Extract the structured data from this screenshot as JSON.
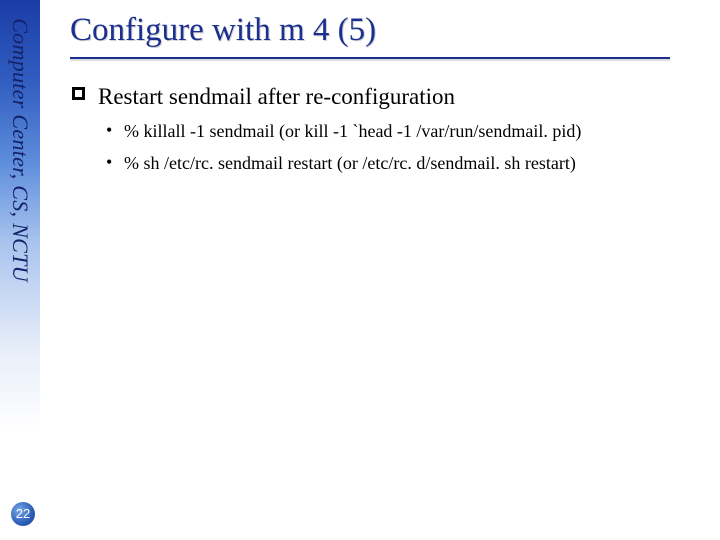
{
  "sidebar": {
    "org_label": "Computer Center, CS, NCTU"
  },
  "page": {
    "number": "22"
  },
  "title": "Configure with m 4 (5)",
  "body": {
    "item1": {
      "text": "Restart sendmail after re-configuration",
      "sub1": "% killall -1 sendmail   (or kill -1 `head -1 /var/run/sendmail. pid)",
      "sub2": "% sh /etc/rc. sendmail restart  (or /etc/rc. d/sendmail. sh restart)"
    }
  }
}
